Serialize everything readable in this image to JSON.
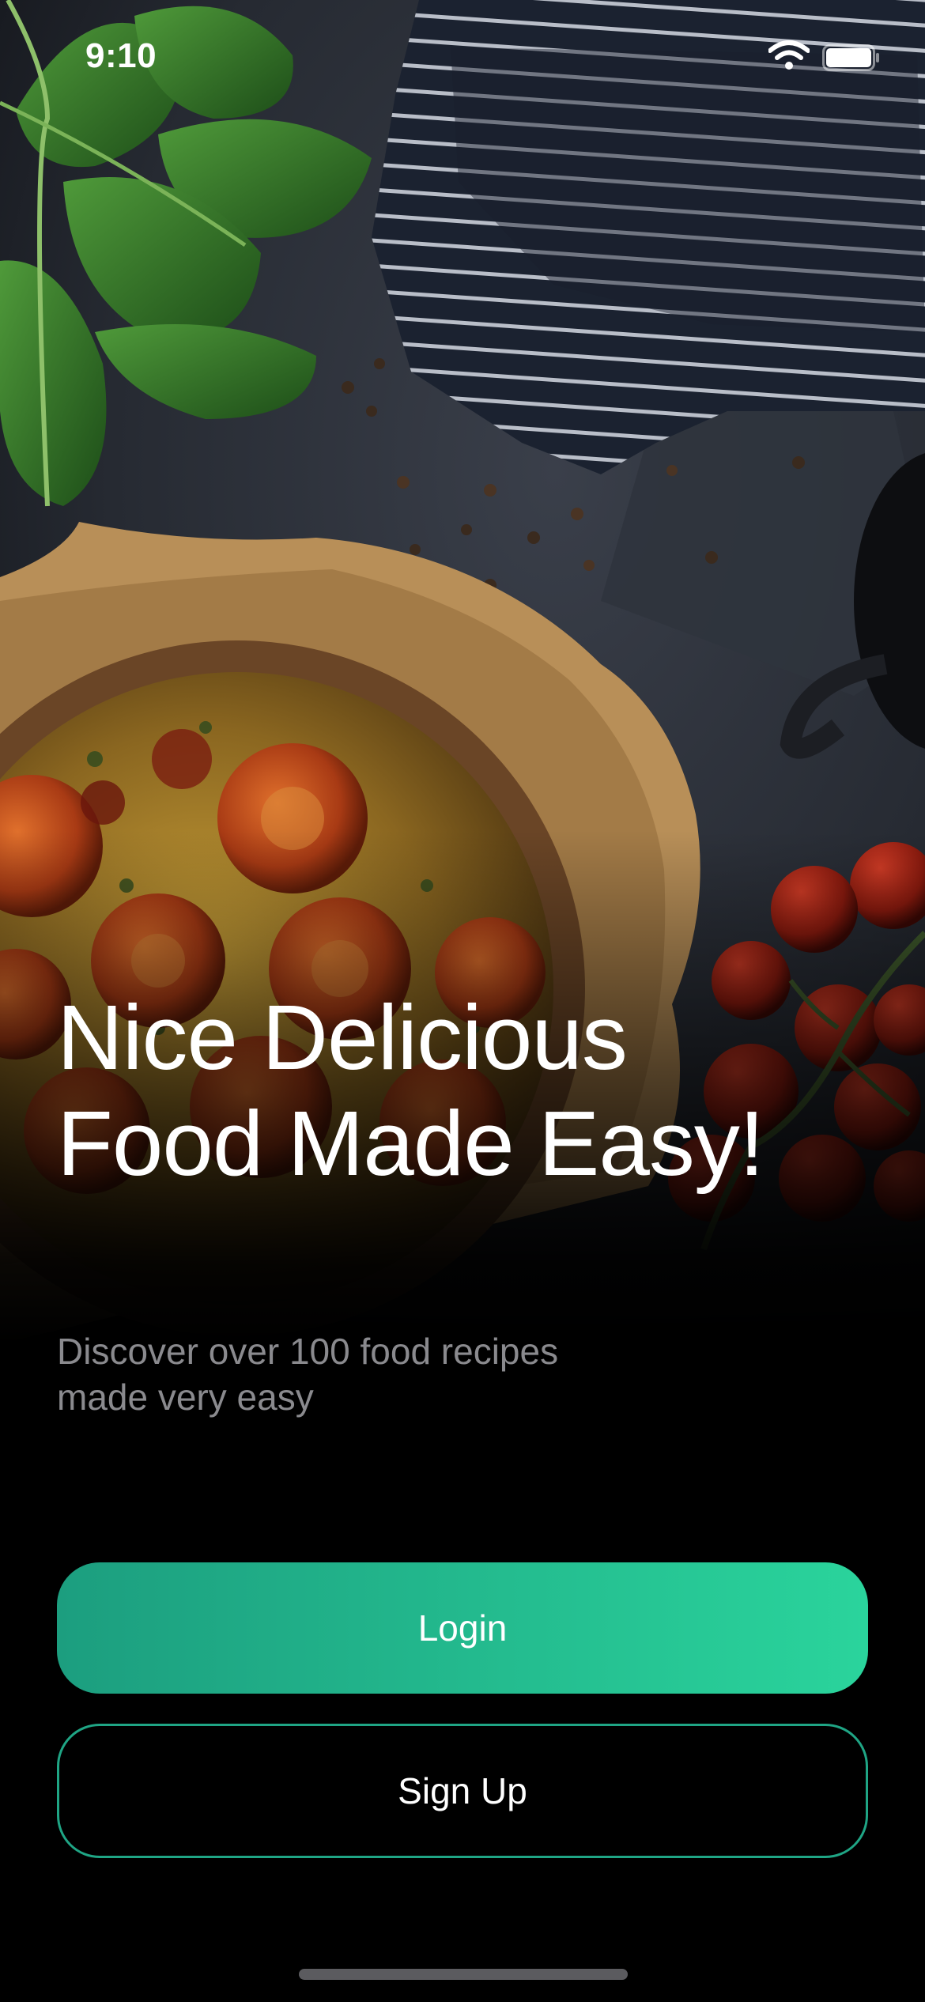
{
  "status_bar": {
    "time": "9:10",
    "icons": [
      "wifi-icon",
      "battery-icon"
    ]
  },
  "hero": {
    "image": "food-background-image",
    "headline": "Nice Delicious Food Made Easy!",
    "subtitle": "Discover over 100 food recipes made very easy"
  },
  "actions": {
    "login_label": "Login",
    "signup_label": "Sign Up"
  },
  "colors": {
    "background": "#000000",
    "accent_start": "#1C9E7F",
    "accent_end": "#2AD49C",
    "outline": "#1FA585",
    "subtitle_text": "#8A8A8E"
  }
}
